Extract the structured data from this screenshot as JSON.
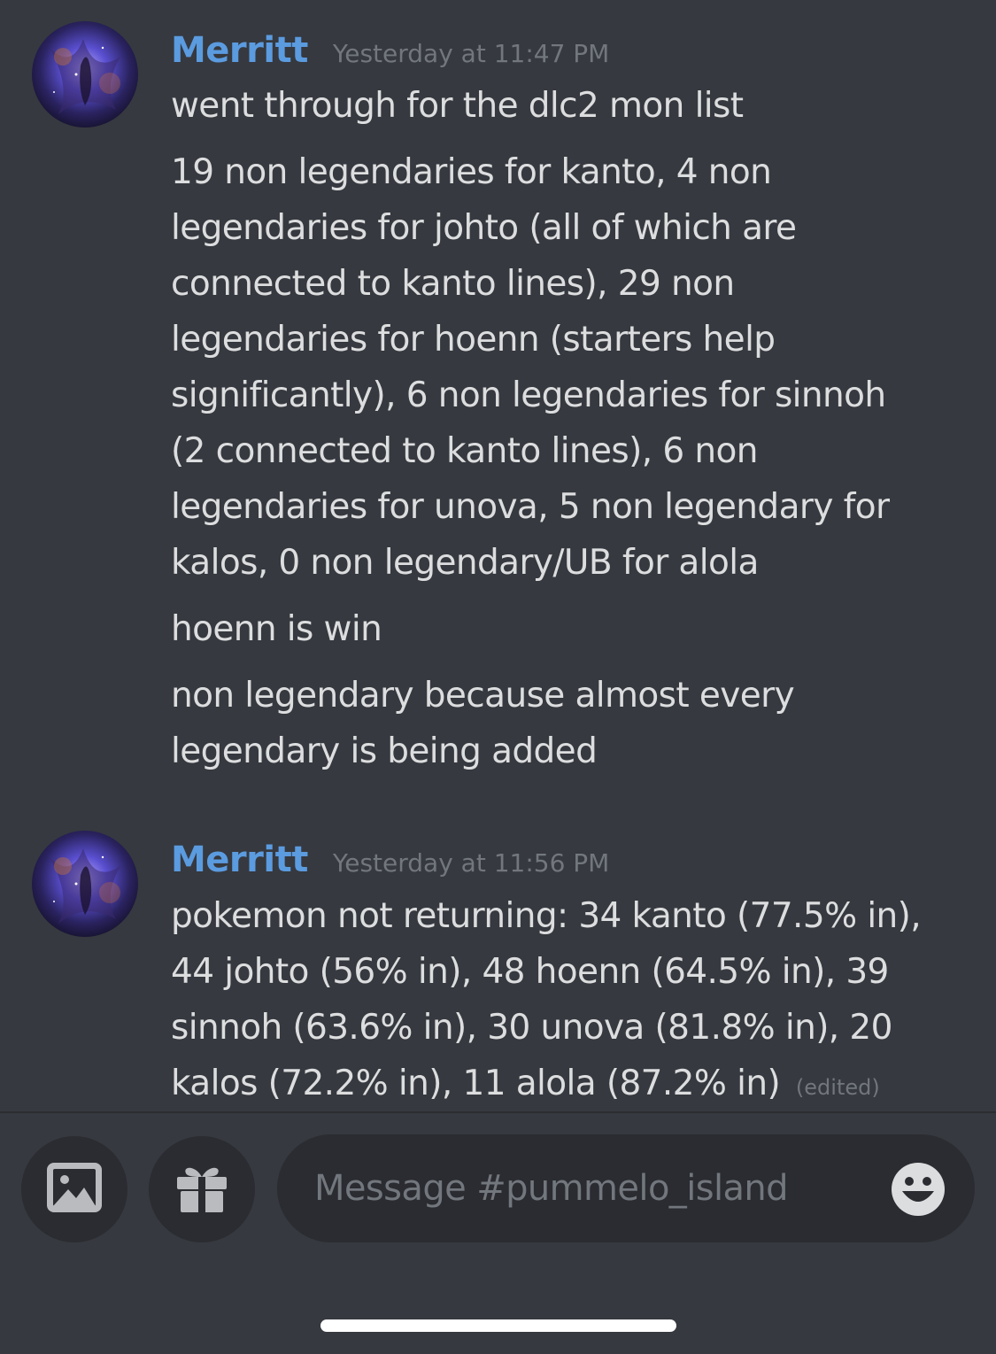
{
  "messages": [
    {
      "author": "Merritt",
      "timestamp": "Yesterday at 11:47 PM",
      "lines": [
        "went through for the dlc2 mon list",
        "19 non legendaries for kanto, 4 non",
        "legendaries for johto (all of which are",
        "connected to kanto lines), 29 non",
        "legendaries for hoenn (starters help",
        "significantly), 6 non legendaries for sinnoh",
        "(2 connected to kanto lines), 6 non",
        "legendaries for unova, 5 non legendary for",
        "kalos, 0 non legendary/UB for alola",
        "hoenn is win",
        "non legendary because almost every",
        "legendary is being added"
      ]
    },
    {
      "author": "Merritt",
      "timestamp": "Yesterday at 11:56 PM",
      "lines": [
        "pokemon not returning: 34 kanto (77.5% in),",
        "44 johto (56% in), 48 hoenn (64.5% in), 39",
        "sinnoh (63.6% in), 30 unova (81.8% in), 20",
        "kalos (72.2% in), 11 alola (87.2% in)"
      ],
      "edited_label": "(edited)"
    }
  ],
  "composer": {
    "placeholder": "Message #pummelo_island"
  },
  "icons": {
    "image": "image-upload-icon",
    "gift": "gift-icon",
    "emoji": "emoji-icon"
  },
  "colors": {
    "background": "#36393f",
    "username": "#5b9be0",
    "text": "#dcddde",
    "muted": "#72767d",
    "button": "#2a2c31"
  }
}
